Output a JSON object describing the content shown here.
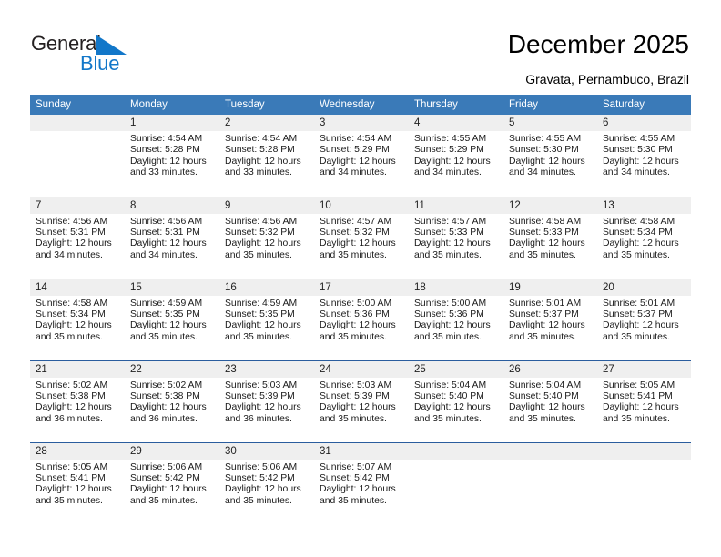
{
  "brand": {
    "name_part1": "General",
    "name_part2": "Blue",
    "triangle_color": "#1277c9"
  },
  "header": {
    "title": "December 2025",
    "subtitle": "Gravata, Pernambuco, Brazil"
  },
  "theme": {
    "header_blue": "#3a7ab8",
    "separator_blue": "#2a5d9e",
    "daynum_gray": "#efefef"
  },
  "calendar": {
    "weekday_headers": [
      "Sunday",
      "Monday",
      "Tuesday",
      "Wednesday",
      "Thursday",
      "Friday",
      "Saturday"
    ],
    "labels": {
      "sunrise": "Sunrise:",
      "sunset": "Sunset:",
      "daylight": "Daylight:"
    },
    "weeks": [
      [
        {
          "day": "",
          "blank": true,
          "sunrise": "",
          "sunset": "",
          "daylight1": "",
          "daylight2": ""
        },
        {
          "day": "1",
          "blank": false,
          "sunrise": "Sunrise: 4:54 AM",
          "sunset": "Sunset: 5:28 PM",
          "daylight1": "Daylight: 12 hours",
          "daylight2": "and 33 minutes."
        },
        {
          "day": "2",
          "blank": false,
          "sunrise": "Sunrise: 4:54 AM",
          "sunset": "Sunset: 5:28 PM",
          "daylight1": "Daylight: 12 hours",
          "daylight2": "and 33 minutes."
        },
        {
          "day": "3",
          "blank": false,
          "sunrise": "Sunrise: 4:54 AM",
          "sunset": "Sunset: 5:29 PM",
          "daylight1": "Daylight: 12 hours",
          "daylight2": "and 34 minutes."
        },
        {
          "day": "4",
          "blank": false,
          "sunrise": "Sunrise: 4:55 AM",
          "sunset": "Sunset: 5:29 PM",
          "daylight1": "Daylight: 12 hours",
          "daylight2": "and 34 minutes."
        },
        {
          "day": "5",
          "blank": false,
          "sunrise": "Sunrise: 4:55 AM",
          "sunset": "Sunset: 5:30 PM",
          "daylight1": "Daylight: 12 hours",
          "daylight2": "and 34 minutes."
        },
        {
          "day": "6",
          "blank": false,
          "sunrise": "Sunrise: 4:55 AM",
          "sunset": "Sunset: 5:30 PM",
          "daylight1": "Daylight: 12 hours",
          "daylight2": "and 34 minutes."
        }
      ],
      [
        {
          "day": "7",
          "blank": false,
          "sunrise": "Sunrise: 4:56 AM",
          "sunset": "Sunset: 5:31 PM",
          "daylight1": "Daylight: 12 hours",
          "daylight2": "and 34 minutes."
        },
        {
          "day": "8",
          "blank": false,
          "sunrise": "Sunrise: 4:56 AM",
          "sunset": "Sunset: 5:31 PM",
          "daylight1": "Daylight: 12 hours",
          "daylight2": "and 34 minutes."
        },
        {
          "day": "9",
          "blank": false,
          "sunrise": "Sunrise: 4:56 AM",
          "sunset": "Sunset: 5:32 PM",
          "daylight1": "Daylight: 12 hours",
          "daylight2": "and 35 minutes."
        },
        {
          "day": "10",
          "blank": false,
          "sunrise": "Sunrise: 4:57 AM",
          "sunset": "Sunset: 5:32 PM",
          "daylight1": "Daylight: 12 hours",
          "daylight2": "and 35 minutes."
        },
        {
          "day": "11",
          "blank": false,
          "sunrise": "Sunrise: 4:57 AM",
          "sunset": "Sunset: 5:33 PM",
          "daylight1": "Daylight: 12 hours",
          "daylight2": "and 35 minutes."
        },
        {
          "day": "12",
          "blank": false,
          "sunrise": "Sunrise: 4:58 AM",
          "sunset": "Sunset: 5:33 PM",
          "daylight1": "Daylight: 12 hours",
          "daylight2": "and 35 minutes."
        },
        {
          "day": "13",
          "blank": false,
          "sunrise": "Sunrise: 4:58 AM",
          "sunset": "Sunset: 5:34 PM",
          "daylight1": "Daylight: 12 hours",
          "daylight2": "and 35 minutes."
        }
      ],
      [
        {
          "day": "14",
          "blank": false,
          "sunrise": "Sunrise: 4:58 AM",
          "sunset": "Sunset: 5:34 PM",
          "daylight1": "Daylight: 12 hours",
          "daylight2": "and 35 minutes."
        },
        {
          "day": "15",
          "blank": false,
          "sunrise": "Sunrise: 4:59 AM",
          "sunset": "Sunset: 5:35 PM",
          "daylight1": "Daylight: 12 hours",
          "daylight2": "and 35 minutes."
        },
        {
          "day": "16",
          "blank": false,
          "sunrise": "Sunrise: 4:59 AM",
          "sunset": "Sunset: 5:35 PM",
          "daylight1": "Daylight: 12 hours",
          "daylight2": "and 35 minutes."
        },
        {
          "day": "17",
          "blank": false,
          "sunrise": "Sunrise: 5:00 AM",
          "sunset": "Sunset: 5:36 PM",
          "daylight1": "Daylight: 12 hours",
          "daylight2": "and 35 minutes."
        },
        {
          "day": "18",
          "blank": false,
          "sunrise": "Sunrise: 5:00 AM",
          "sunset": "Sunset: 5:36 PM",
          "daylight1": "Daylight: 12 hours",
          "daylight2": "and 35 minutes."
        },
        {
          "day": "19",
          "blank": false,
          "sunrise": "Sunrise: 5:01 AM",
          "sunset": "Sunset: 5:37 PM",
          "daylight1": "Daylight: 12 hours",
          "daylight2": "and 35 minutes."
        },
        {
          "day": "20",
          "blank": false,
          "sunrise": "Sunrise: 5:01 AM",
          "sunset": "Sunset: 5:37 PM",
          "daylight1": "Daylight: 12 hours",
          "daylight2": "and 35 minutes."
        }
      ],
      [
        {
          "day": "21",
          "blank": false,
          "sunrise": "Sunrise: 5:02 AM",
          "sunset": "Sunset: 5:38 PM",
          "daylight1": "Daylight: 12 hours",
          "daylight2": "and 36 minutes."
        },
        {
          "day": "22",
          "blank": false,
          "sunrise": "Sunrise: 5:02 AM",
          "sunset": "Sunset: 5:38 PM",
          "daylight1": "Daylight: 12 hours",
          "daylight2": "and 36 minutes."
        },
        {
          "day": "23",
          "blank": false,
          "sunrise": "Sunrise: 5:03 AM",
          "sunset": "Sunset: 5:39 PM",
          "daylight1": "Daylight: 12 hours",
          "daylight2": "and 36 minutes."
        },
        {
          "day": "24",
          "blank": false,
          "sunrise": "Sunrise: 5:03 AM",
          "sunset": "Sunset: 5:39 PM",
          "daylight1": "Daylight: 12 hours",
          "daylight2": "and 35 minutes."
        },
        {
          "day": "25",
          "blank": false,
          "sunrise": "Sunrise: 5:04 AM",
          "sunset": "Sunset: 5:40 PM",
          "daylight1": "Daylight: 12 hours",
          "daylight2": "and 35 minutes."
        },
        {
          "day": "26",
          "blank": false,
          "sunrise": "Sunrise: 5:04 AM",
          "sunset": "Sunset: 5:40 PM",
          "daylight1": "Daylight: 12 hours",
          "daylight2": "and 35 minutes."
        },
        {
          "day": "27",
          "blank": false,
          "sunrise": "Sunrise: 5:05 AM",
          "sunset": "Sunset: 5:41 PM",
          "daylight1": "Daylight: 12 hours",
          "daylight2": "and 35 minutes."
        }
      ],
      [
        {
          "day": "28",
          "blank": false,
          "sunrise": "Sunrise: 5:05 AM",
          "sunset": "Sunset: 5:41 PM",
          "daylight1": "Daylight: 12 hours",
          "daylight2": "and 35 minutes."
        },
        {
          "day": "29",
          "blank": false,
          "sunrise": "Sunrise: 5:06 AM",
          "sunset": "Sunset: 5:42 PM",
          "daylight1": "Daylight: 12 hours",
          "daylight2": "and 35 minutes."
        },
        {
          "day": "30",
          "blank": false,
          "sunrise": "Sunrise: 5:06 AM",
          "sunset": "Sunset: 5:42 PM",
          "daylight1": "Daylight: 12 hours",
          "daylight2": "and 35 minutes."
        },
        {
          "day": "31",
          "blank": false,
          "sunrise": "Sunrise: 5:07 AM",
          "sunset": "Sunset: 5:42 PM",
          "daylight1": "Daylight: 12 hours",
          "daylight2": "and 35 minutes."
        },
        {
          "day": "",
          "blank": true,
          "sunrise": "",
          "sunset": "",
          "daylight1": "",
          "daylight2": ""
        },
        {
          "day": "",
          "blank": true,
          "sunrise": "",
          "sunset": "",
          "daylight1": "",
          "daylight2": ""
        },
        {
          "day": "",
          "blank": true,
          "sunrise": "",
          "sunset": "",
          "daylight1": "",
          "daylight2": ""
        }
      ]
    ]
  }
}
